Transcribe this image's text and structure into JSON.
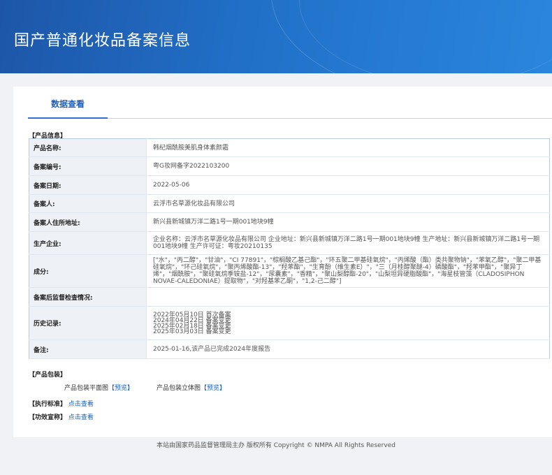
{
  "header": {
    "title": "国产普通化妆品备案信息"
  },
  "tabs": [
    {
      "label": "数据查看"
    }
  ],
  "product_info": {
    "section_label": "【产品信息】",
    "rows": [
      {
        "key": "产品名称:",
        "value": "韩纪烟酰胺美肌身体素颜霜"
      },
      {
        "key": "备案编号:",
        "value": "粤G妆网备字2022103200"
      },
      {
        "key": "备案日期:",
        "value": "2022-05-06"
      },
      {
        "key": "备案人:",
        "value": "云浮市名草源化妆品有限公司"
      },
      {
        "key": "备案人住所地址:",
        "value": "新兴县新城镇万洋二路1号一期001地块9幢"
      },
      {
        "key": "生产企业:",
        "value": "企业名称：云浮市名草源化妆品有限公司 企业地址：新兴县新城镇万洋二路1号一期001地块9幢 生产地址：新兴县新城镇万洋二路1号一期001地块9幢 生产许可证：粤妆20210135"
      },
      {
        "key": "成分:",
        "value": "[\"水\"，\"丙二醇\"，\"甘油\"，\"CI 77891\"，\"棕榈酸乙基己酯\"，\"环五聚二甲基硅氧烷\"，\"丙烯酸（酯）类共聚物钠\"，\"苯氧乙醇\"，\"聚二甲基硅氧烷\"，\"环己硅氧烷\"，\"聚丙烯酸酯-13\"，\"羟苯酯\"，\"生育酚（维生素E）\"，\"三（月桂醇聚醚-4）磷酸酯\"，\"羟苯甲酯\"，\"聚异丁烯\"，\"烟酰胺\"，\"聚硅氧烷季铵盐-12\"，\"尿囊素\"，\"香精\"，\"聚山梨醇酯-20\"，\"山梨坦异硬脂酸酯\"，\"海星枝管藻（CLADOSIPHON NOVAE-CALEDONIAE）提取物\"，\"对羟基苯乙酮\"，\"1,2-己二醇\"]"
      },
      {
        "key": "备案后监督检查情况:",
        "value": ""
      },
      {
        "key": "历史记录:",
        "value": "2022年05月10日 首次备案\n2024年04月22日 备案变更\n2025年02月18日 备案变更\n2025年03月03日 备案变更"
      },
      {
        "key": "备注:",
        "value": "2025-01-16,该产品已完成2024年度报告"
      }
    ]
  },
  "packaging": {
    "section_label": "【产品包装】",
    "flat_label": "产品包装平面图",
    "flat_link": "【预览】",
    "stereo_label": "产品包装立体图",
    "stereo_link": "【预览】"
  },
  "standard": {
    "label": "【执行标准】",
    "link": "点击查看"
  },
  "efficacy": {
    "label": "【功效宣称】",
    "link": "点击查看"
  },
  "footer": {
    "text": "本站由国家药品监督管理局主办 版权所有 Copyright © NMPA All Rights Reserved"
  }
}
